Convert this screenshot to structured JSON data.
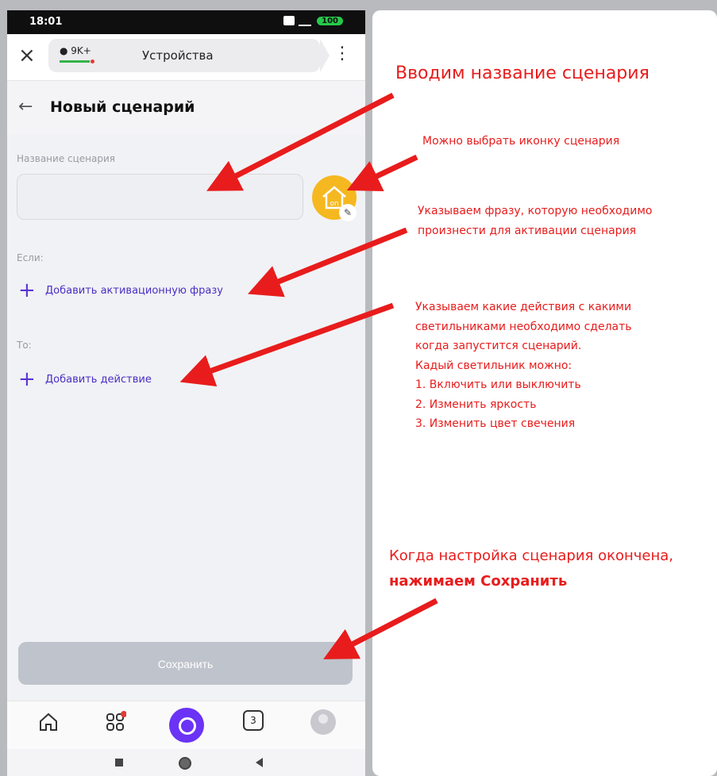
{
  "status_bar": {
    "time": "18:01",
    "battery": "100"
  },
  "top_bar": {
    "chat_count": "9K+",
    "url_title": "Устройства"
  },
  "header": {
    "title": "Новый сценарий"
  },
  "form": {
    "name_label": "Название сценария",
    "name_value": "",
    "if_label": "Если:",
    "add_phrase": "Добавить активационную фразу",
    "then_label": "То:",
    "add_action": "Добавить действие",
    "save": "Сохранить"
  },
  "bottom_nav": {
    "tabs_count": "3"
  },
  "annotations": {
    "name": "Вводим название сценария",
    "icon": "Можно выбрать иконку сценария",
    "phrase_line1": "Указываем фразу, которую необходимо",
    "phrase_line2": "произнести для активации сценария",
    "actions": [
      "Указываем какие действия с какими",
      "светильниками необходимо сделать",
      "когда запустится сценарий.",
      "Кадый светильник можно:",
      "1. Включить или выключить",
      "2. Изменить яркость",
      "3. Изменить цвет свечения"
    ],
    "save_line1": "Когда настройка сценария окончена,",
    "save_line2": "нажимаем Сохранить"
  },
  "colors": {
    "accent": "#5b34d6",
    "annotation": "#e81c1c",
    "icon_bg": "#f5b820"
  }
}
